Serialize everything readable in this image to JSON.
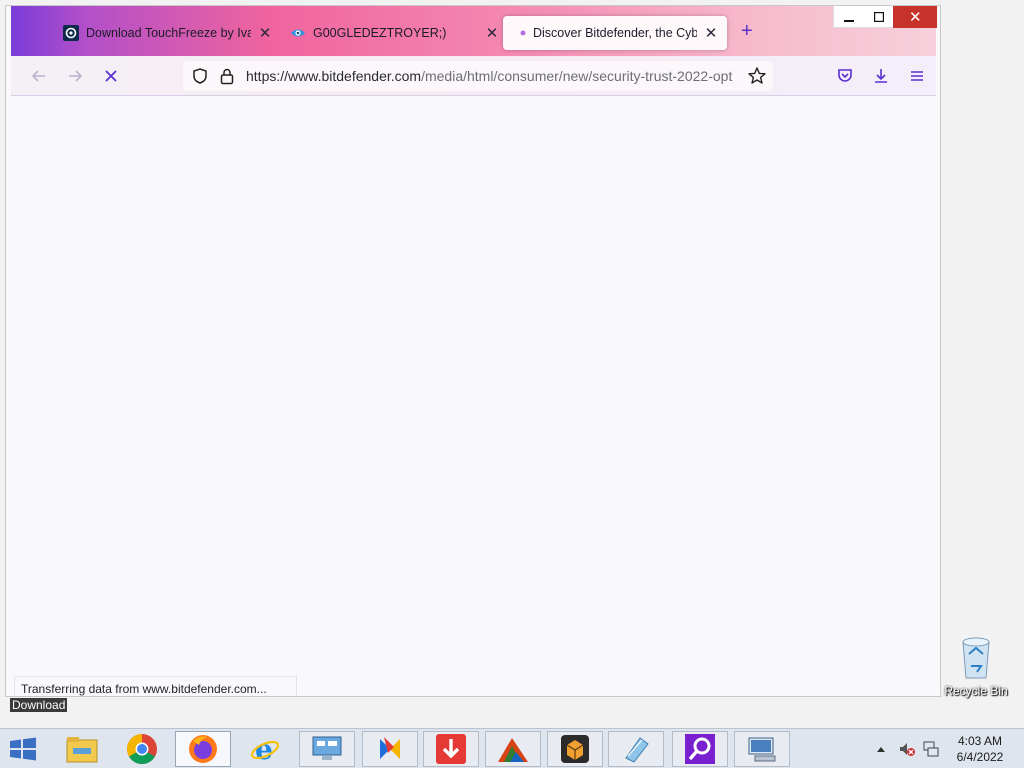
{
  "desktop": {
    "download_label": "Download",
    "recycle_bin_label": "Recycle Bin"
  },
  "browser": {
    "tabs": [
      {
        "title": "Download TouchFreeze by Ivan",
        "icon": "touchfreeze-favicon-icon",
        "active": false
      },
      {
        "title": "G00GLEDEZTROYER;)",
        "icon": "eye-favicon-icon",
        "active": false
      },
      {
        "title": "Discover Bitdefender, the Cyber",
        "icon": "loading-dot-icon",
        "active": true
      }
    ],
    "url_domain": "https://www.bitdefender.com",
    "url_path": "/media/html/consumer/new/security-trust-2022-opt",
    "status_text": "Transferring data from www.bitdefender.com...",
    "accent_color": "#5b2fd0"
  },
  "taskbar": {
    "apps": [
      "file-explorer-icon",
      "chrome-icon",
      "firefox-icon",
      "internet-explorer-icon",
      "network-monitor-icon",
      "app-icon",
      "download-arrow-icon",
      "winrar-icon",
      "virtualbox-icon",
      "notepad-icon",
      "search-app-icon",
      "remote-desktop-icon"
    ],
    "time": "4:03 AM",
    "date": "6/4/2022"
  }
}
